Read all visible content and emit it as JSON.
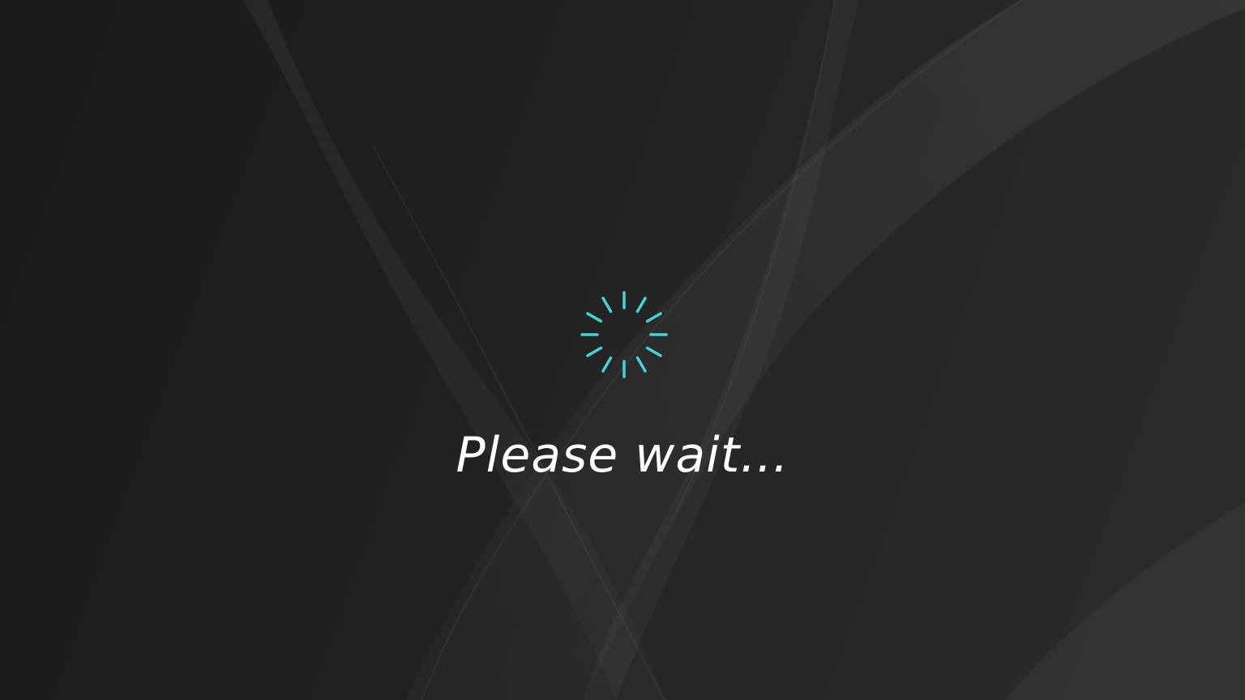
{
  "loading_screen": {
    "status_text": "Please wait...",
    "spinner_icon": "loading-spinner-icon",
    "spinner_color": "#3fd6d6",
    "background_color": "#1b1b1b",
    "text_color": "#ffffff"
  }
}
